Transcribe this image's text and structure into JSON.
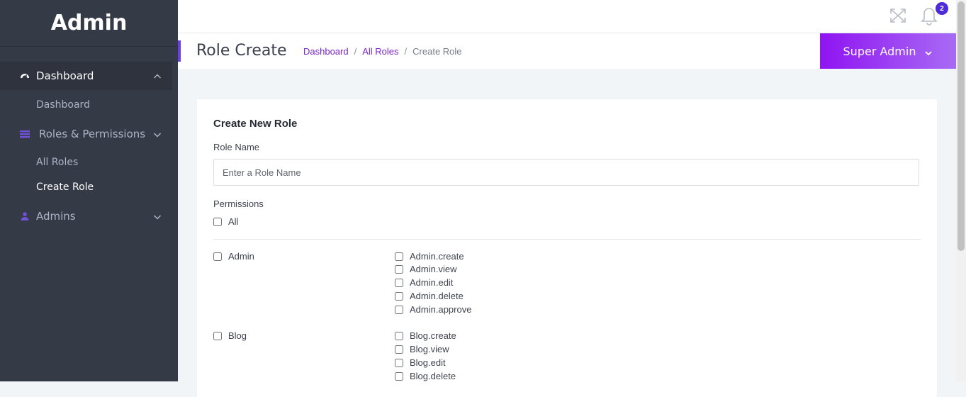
{
  "sidebar": {
    "brand": "Admin",
    "groups": [
      {
        "label": "Dashboard",
        "icon": "dashboard-icon",
        "expanded": true
      },
      {
        "label": "Roles & Permissions",
        "icon": "roles-icon",
        "expanded": false
      },
      {
        "label": "Admins",
        "icon": "user-icon",
        "expanded": false
      }
    ],
    "dashboard_items": [
      "Dashboard"
    ],
    "role_items": [
      "All Roles",
      "Create Role"
    ]
  },
  "topbar": {
    "notification_count": "2"
  },
  "header": {
    "page_title": "Role Create",
    "breadcrumb": [
      {
        "label": "Dashboard",
        "link": true
      },
      {
        "label": "All Roles",
        "link": true
      },
      {
        "label": "Create Role",
        "link": false
      }
    ],
    "user_name": "Super Admin"
  },
  "form": {
    "card_title": "Create New Role",
    "role_name_label": "Role Name",
    "role_name_placeholder": "Enter a Role Name",
    "role_name_value": "",
    "permissions_label": "Permissions",
    "all_label": "All",
    "groups": [
      {
        "name": "Admin",
        "permissions": [
          "Admin.create",
          "Admin.view",
          "Admin.edit",
          "Admin.delete",
          "Admin.approve"
        ]
      },
      {
        "name": "Blog",
        "permissions": [
          "Blog.create",
          "Blog.view",
          "Blog.edit",
          "Blog.delete"
        ]
      }
    ]
  },
  "colors": {
    "sidebar_bg": "#343a46",
    "accent": "#7a25c9",
    "user_button_gradient_start": "#8f14f2",
    "badge": "#4e2ad9"
  }
}
